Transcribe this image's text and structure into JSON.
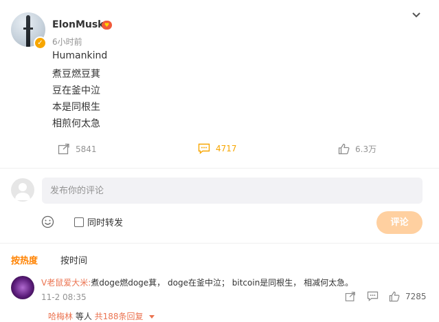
{
  "post": {
    "author": "ElonMusk",
    "time_ago": "6小时前",
    "lines": [
      "Humankind",
      "煮豆燃豆萁",
      "豆在釜中泣",
      "本是同根生",
      "相煎何太急"
    ],
    "actions": {
      "repost_count": "5841",
      "comment_count": "4717",
      "like_count": "6.3万"
    }
  },
  "composer": {
    "placeholder": "发布你的评论",
    "repost_label": "同时转发",
    "submit_label": "评论"
  },
  "sort_tabs": {
    "hot": "按热度",
    "time": "按时间"
  },
  "comments": [
    {
      "username": "V老鼠爱大米:",
      "text": "煮doge燃doge萁， doge在釜中泣； bitcoin是同根生， 相减何太急。",
      "date": "11-2 08:35",
      "like_count": "7285",
      "reply": {
        "user": "哈梅林",
        "middle": " 等人 ",
        "count": "共188条回复"
      }
    }
  ],
  "colors": {
    "accent": "#ff8200",
    "active_action": "#f7a600",
    "link_user": "#eb7350",
    "submit_disabled": "#ffd0a0"
  }
}
